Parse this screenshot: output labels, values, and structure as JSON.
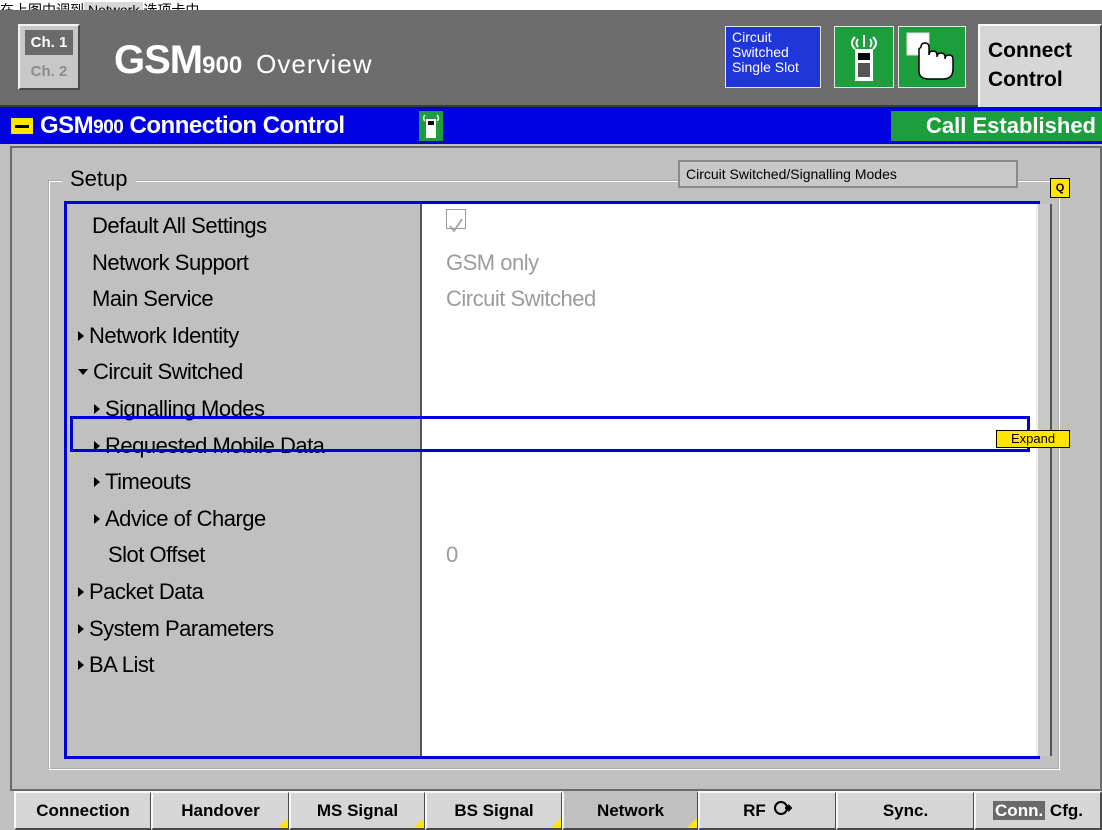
{
  "caption": {
    "before": "在上图中调到",
    "highlight": "Network",
    "after": "选项卡中。"
  },
  "header": {
    "channel1": "Ch. 1",
    "channel2": "Ch. 2",
    "title_gsm": "GSM",
    "title_band": "900",
    "title_view": "Overview",
    "mode_lines": [
      "Circuit",
      "Switched",
      "Single Slot"
    ],
    "connect_control": [
      "Connect",
      "Control"
    ]
  },
  "panel": {
    "title_gsm": "GSM",
    "title_band": "900",
    "title_rest": "Connection Control",
    "call_status": "Call Established",
    "setup_label": "Setup",
    "mode_header": "Circuit Switched/Signalling Modes",
    "q_marker": "Q",
    "expand_label": "Expand"
  },
  "tree": [
    {
      "label": "Default All Settings",
      "indent": 0,
      "arrow": "none",
      "value": "checked"
    },
    {
      "label": "Network Support",
      "indent": 0,
      "arrow": "none",
      "value": "GSM only"
    },
    {
      "label": "Main Service",
      "indent": 0,
      "arrow": "none",
      "value": "Circuit Switched"
    },
    {
      "label": "Network Identity",
      "indent": 0,
      "arrow": "right",
      "value": ""
    },
    {
      "label": "Circuit Switched",
      "indent": 0,
      "arrow": "down",
      "value": ""
    },
    {
      "label": "Signalling Modes",
      "indent": 1,
      "arrow": "right",
      "value": ""
    },
    {
      "label": "Requested Mobile Data",
      "indent": 1,
      "arrow": "right",
      "value": ""
    },
    {
      "label": "Timeouts",
      "indent": 1,
      "arrow": "right",
      "value": ""
    },
    {
      "label": "Advice of Charge",
      "indent": 1,
      "arrow": "right",
      "value": ""
    },
    {
      "label": "Slot Offset",
      "indent": 1,
      "arrow": "none",
      "value": "0"
    },
    {
      "label": "Packet Data",
      "indent": 0,
      "arrow": "right",
      "value": ""
    },
    {
      "label": "System Parameters",
      "indent": 0,
      "arrow": "right",
      "value": ""
    },
    {
      "label": "BA List",
      "indent": 0,
      "arrow": "right",
      "value": ""
    }
  ],
  "tabs": [
    {
      "label": "Connection"
    },
    {
      "label": "Handover"
    },
    {
      "label": "MS Signal"
    },
    {
      "label": "BS Signal"
    },
    {
      "label": "Network"
    },
    {
      "label": "RF"
    },
    {
      "label": "Sync."
    },
    {
      "label": "Cfg.",
      "prefix": "Conn."
    }
  ],
  "active_tab": "Network",
  "colors": {
    "blue_bar": "#0000e0",
    "status_green": "#1d9e3c",
    "marker_yellow": "#ffe600"
  }
}
